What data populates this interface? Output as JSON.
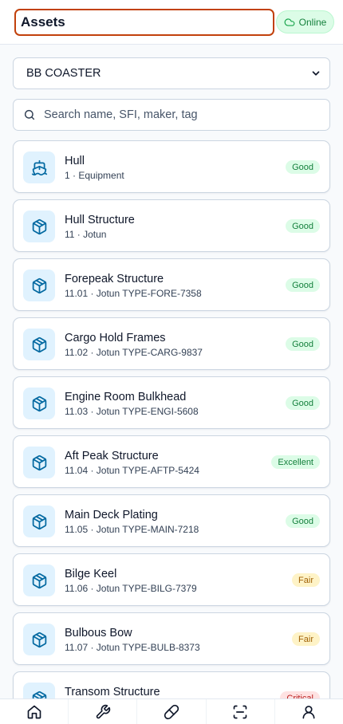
{
  "header": {
    "title": "Assets",
    "status": "Online"
  },
  "vessel_select": {
    "value": "BB COASTER"
  },
  "search": {
    "placeholder": "Search name, SFI, maker, tag"
  },
  "status_colors": {
    "Good": {
      "bg": "#dcfce7",
      "fg": "#15803d"
    },
    "Excellent": {
      "bg": "#dcfce7",
      "fg": "#15803d"
    },
    "Fair": {
      "bg": "#fef3c7",
      "fg": "#a16207"
    },
    "Critical": {
      "bg": "#fee2e2",
      "fg": "#b91c1c"
    }
  },
  "assets": [
    {
      "name": "Hull",
      "sub": "1 · Equipment",
      "status": "Good",
      "icon": "ship-icon"
    },
    {
      "name": "Hull Structure",
      "sub": "11 · Jotun",
      "status": "Good",
      "icon": "box-icon"
    },
    {
      "name": "Forepeak Structure",
      "sub": "11.01 · Jotun TYPE-FORE-7358",
      "status": "Good",
      "icon": "box-icon"
    },
    {
      "name": "Cargo Hold Frames",
      "sub": "11.02 · Jotun TYPE-CARG-9837",
      "status": "Good",
      "icon": "box-icon"
    },
    {
      "name": "Engine Room Bulkhead",
      "sub": "11.03 · Jotun TYPE-ENGI-5608",
      "status": "Good",
      "icon": "box-icon"
    },
    {
      "name": "Aft Peak Structure",
      "sub": "11.04 · Jotun TYPE-AFTP-5424",
      "status": "Excellent",
      "icon": "box-icon"
    },
    {
      "name": "Main Deck Plating",
      "sub": "11.05 · Jotun TYPE-MAIN-7218",
      "status": "Good",
      "icon": "box-icon"
    },
    {
      "name": "Bilge Keel",
      "sub": "11.06 · Jotun TYPE-BILG-7379",
      "status": "Fair",
      "icon": "box-icon"
    },
    {
      "name": "Bulbous Bow",
      "sub": "11.07 · Jotun TYPE-BULB-8373",
      "status": "Fair",
      "icon": "box-icon"
    },
    {
      "name": "Transom Structure",
      "sub": "",
      "status": "Critical",
      "icon": "box-icon"
    }
  ],
  "bottom_nav": [
    {
      "icon": "home-icon",
      "name": "nav-home"
    },
    {
      "icon": "wrench-icon",
      "name": "nav-maintenance"
    },
    {
      "icon": "pill-icon",
      "name": "nav-supplies"
    },
    {
      "icon": "scan-icon",
      "name": "nav-scan"
    },
    {
      "icon": "user-icon",
      "name": "nav-profile"
    }
  ]
}
